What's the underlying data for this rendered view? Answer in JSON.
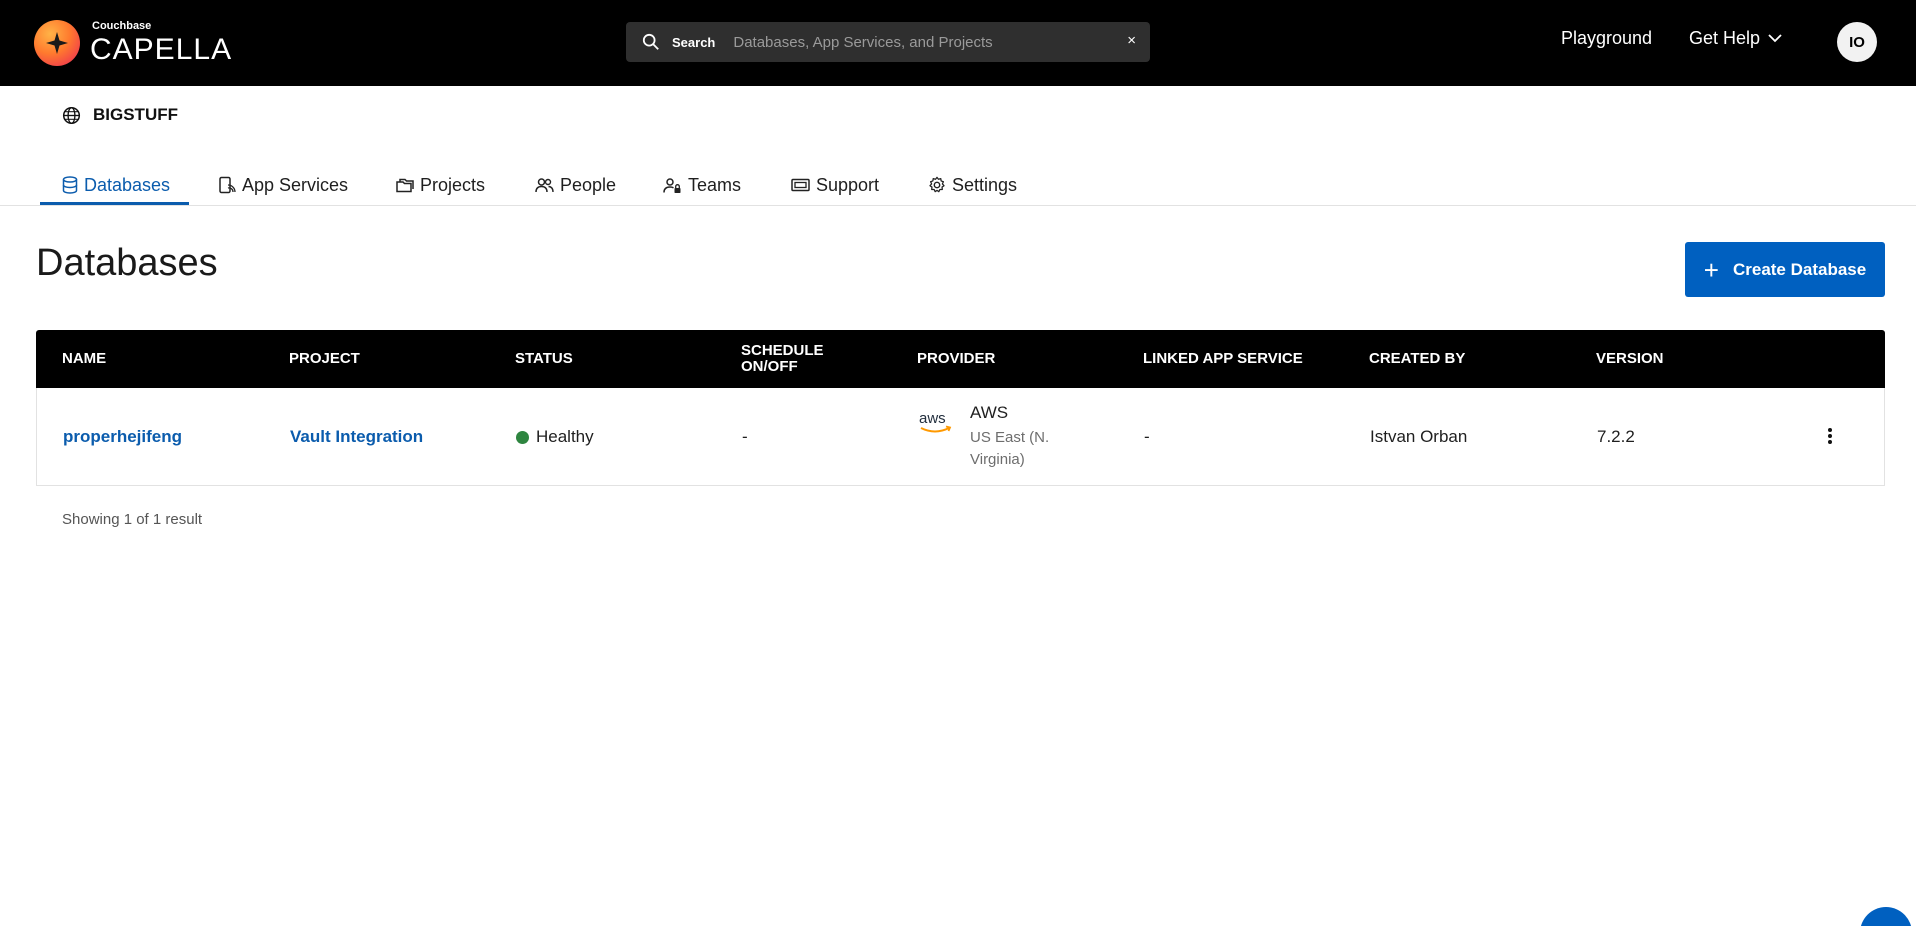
{
  "header": {
    "logo_small": "Couchbase",
    "logo_big": "CAPELLA",
    "search": {
      "label": "Search",
      "placeholder": "Databases, App Services, and Projects",
      "clear": "×"
    },
    "playground": "Playground",
    "get_help": "Get Help",
    "avatar_initials": "IO"
  },
  "org": {
    "name": "BIGSTUFF"
  },
  "tabs": [
    {
      "label": "Databases",
      "icon": "database-icon",
      "active": true
    },
    {
      "label": "App Services",
      "icon": "app-services-icon"
    },
    {
      "label": "Projects",
      "icon": "folders-icon"
    },
    {
      "label": "People",
      "icon": "people-icon"
    },
    {
      "label": "Teams",
      "icon": "teams-icon"
    },
    {
      "label": "Support",
      "icon": "ticket-icon"
    },
    {
      "label": "Settings",
      "icon": "gear-icon"
    }
  ],
  "page": {
    "title": "Databases",
    "create_button": {
      "plus": "+",
      "label": "Create Database"
    }
  },
  "table": {
    "columns": [
      "NAME",
      "PROJECT",
      "STATUS",
      "SCHEDULE\nON/OFF",
      "PROVIDER",
      "LINKED APP SERVICE",
      "CREATED BY",
      "VERSION"
    ],
    "rows": [
      {
        "name": "properhejifeng",
        "project": "Vault Integration",
        "status": "Healthy",
        "schedule": "-",
        "provider": "AWS",
        "provider_logo": "aws",
        "region": "US East (N. Virginia)",
        "linked_app_service": "-",
        "created_by": "Istvan Orban",
        "version": "7.2.2"
      }
    ],
    "result_text": "Showing 1 of 1 result"
  },
  "colors": {
    "accent": "#0060c0",
    "link": "#0b5cad",
    "healthy": "#2e8540",
    "header_bg": "#000000"
  }
}
